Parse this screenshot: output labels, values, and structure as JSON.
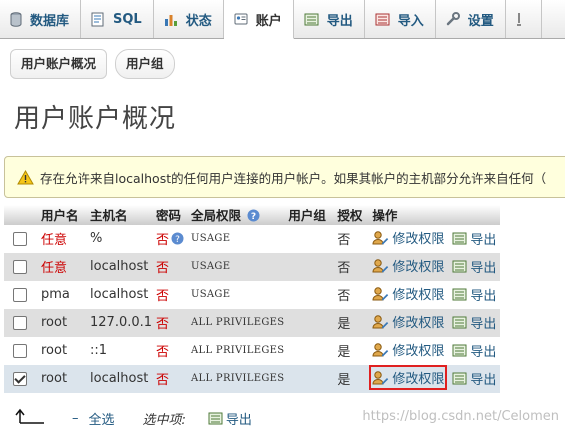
{
  "tabs": [
    {
      "label": "数据库",
      "icon": "database-icon",
      "active": false
    },
    {
      "label": "SQL",
      "icon": "sql-icon",
      "active": false
    },
    {
      "label": "状态",
      "icon": "status-chart-icon",
      "active": false
    },
    {
      "label": "账户",
      "icon": "accounts-icon",
      "active": true
    },
    {
      "label": "导出",
      "icon": "export-icon",
      "active": false
    },
    {
      "label": "导入",
      "icon": "import-icon",
      "active": false
    },
    {
      "label": "设置",
      "icon": "wrench-icon",
      "active": false
    }
  ],
  "subtabs": [
    "用户账户概况",
    "用户组"
  ],
  "page_title": "用户账户概况",
  "notice": "存在允许来自localhost的任何用户连接的用户帐户。如果其帐户的主机部分允许来自任何（",
  "table": {
    "headers": [
      "用户名",
      "主机名",
      "密码",
      "全局权限",
      "用户组",
      "授权",
      "操作"
    ],
    "rows": [
      {
        "user": "任意",
        "user_red": true,
        "host": "%",
        "password": "否",
        "privileges": "USAGE",
        "group": "",
        "grant": "否",
        "checked": false
      },
      {
        "user": "任意",
        "user_red": true,
        "host": "localhost",
        "password": "否",
        "privileges": "USAGE",
        "group": "",
        "grant": "否",
        "checked": false
      },
      {
        "user": "pma",
        "user_red": false,
        "host": "localhost",
        "password": "否",
        "privileges": "USAGE",
        "group": "",
        "grant": "否",
        "checked": false
      },
      {
        "user": "root",
        "user_red": false,
        "host": "127.0.0.1",
        "password": "否",
        "privileges": "ALL PRIVILEGES",
        "group": "",
        "grant": "是",
        "checked": false
      },
      {
        "user": "root",
        "user_red": false,
        "host": "::1",
        "password": "否",
        "privileges": "ALL PRIVILEGES",
        "group": "",
        "grant": "是",
        "checked": false
      },
      {
        "user": "root",
        "user_red": false,
        "host": "localhost",
        "password": "否",
        "privileges": "ALL PRIVILEGES",
        "group": "",
        "grant": "是",
        "checked": true
      }
    ],
    "edit_label": "修改权限",
    "export_label": "导出"
  },
  "footer": {
    "select_all": "全选",
    "with_selected": "选中项:",
    "export_label": "导出"
  },
  "watermark": "https://blog.csdn.net/Celomen",
  "colors": {
    "link": "#235a81",
    "danger": "#cc0000",
    "highlight_border": "#e02020",
    "notice_bg": "#ffffdd"
  }
}
